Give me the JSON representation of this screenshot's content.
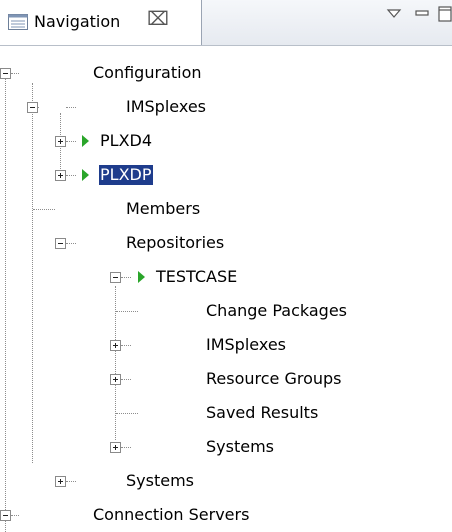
{
  "view": {
    "title": "Navigation",
    "icons": {
      "view": "list-view-icon",
      "close": "close-icon",
      "menu": "view-menu-icon",
      "minimize": "minimize-icon",
      "maximize": "maximize-icon"
    },
    "close_glyph": "⌧"
  },
  "colors": {
    "selection": "#1e3c8c",
    "arrow": "#2aa52a",
    "tab_border": "#9aa4b3"
  },
  "tree": {
    "configuration": "Configuration",
    "imsplexes": "IMSplexes",
    "plxd4": "PLXD4",
    "plxdp": "PLXDP",
    "members": "Members",
    "repositories": "Repositories",
    "testcase": "TESTCASE",
    "change_packages": "Change Packages",
    "tc_imsplexes": "IMSplexes",
    "resource_groups": "Resource Groups",
    "saved_results": "Saved Results",
    "tc_systems": "Systems",
    "systems": "Systems",
    "connection_servers": "Connection Servers",
    "selected_item": "PLXDP"
  }
}
